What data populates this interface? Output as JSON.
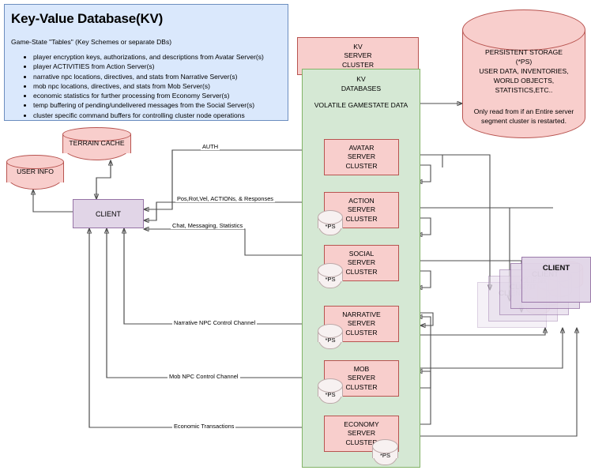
{
  "kv_panel": {
    "title": "Key-Value Database(KV)",
    "subtitle": "Game-State \"Tables\" (Key Schemes or separate DBs)",
    "bullets": [
      "player encryption keys, authorizations, and descriptions from Avatar Server(s)",
      "player ACTIVITIES from Action Server(s)",
      "narrative npc locations, directives, and stats from Narrative Server(s)",
      "mob npc locations, directives, and stats from Mob Server(s)",
      "economic statistics for further processing from Economy Server(s)",
      "temp buffering of pending/undelivered messages from the Social Server(s)",
      "cluster specific command buffers for controlling cluster node operations"
    ]
  },
  "kv_server_cluster": {
    "label": "KV\nSERVER\nCLUSTER",
    "line1": "KV",
    "line2": "SERVER",
    "line3": "CLUSTER"
  },
  "kv_databases": {
    "line1": "KV",
    "line2": "DATABASES",
    "line3": "VOLATILE GAMESTATE DATA"
  },
  "persistent_storage": {
    "title": "PERSISTENT STORAGE\n(*PS)\nUSER DATA, INVENTORIES,\nWORLD OBJECTS,\nSTATISTICS,ETC..",
    "note": "Only read from if an Entire server segment cluster is restarted."
  },
  "left_stores": [
    {
      "name": "user-info",
      "label": "USER INFO"
    },
    {
      "name": "terrain-cache",
      "label": "TERRAIN CACHE"
    }
  ],
  "client": {
    "label": "CLIENT"
  },
  "server_clusters": [
    {
      "id": "avatar",
      "name": "AVATAR",
      "line2": "SERVER",
      "line3": "CLUSTER",
      "ps": false,
      "ps_label": ""
    },
    {
      "id": "action",
      "name": "ACTION",
      "line2": "SERVER",
      "line3": "CLUSTER",
      "ps": true,
      "ps_label": "*PS"
    },
    {
      "id": "social",
      "name": "SOCIAL",
      "line2": "SERVER",
      "line3": "CLUSTER",
      "ps": true,
      "ps_label": "*PS"
    },
    {
      "id": "narrative",
      "name": "NARRATIVE",
      "line2": "SERVER",
      "line3": "CLUSTER",
      "ps": true,
      "ps_label": "*PS"
    },
    {
      "id": "mob",
      "name": "MOB",
      "line2": "SERVER",
      "line3": "CLUSTER",
      "ps": true,
      "ps_label": "*PS"
    },
    {
      "id": "economy",
      "name": "ECONOMY",
      "line2": "SERVER",
      "line3": "CLUSTER",
      "ps": true,
      "ps_label": "*PS"
    }
  ],
  "channels": [
    {
      "id": "auth",
      "label": "AUTH"
    },
    {
      "id": "posrotvel",
      "label": "Pos,Rot,Vel, ACTIONs, & Responses"
    },
    {
      "id": "chat",
      "label": "Chat, Messaging, Statistics"
    },
    {
      "id": "narrative",
      "label": "Narrative NPC Control Channel"
    },
    {
      "id": "mob",
      "label": "Mob NPC Control Channel"
    },
    {
      "id": "economic",
      "label": "Economic Transactions"
    }
  ],
  "client_stack": {
    "labels": [
      "CLIENT",
      "CLIENT",
      "CLIENT",
      "CLIENT",
      "CLIENT"
    ]
  },
  "colors": {
    "pink_fill": "#f8cecc",
    "pink_border": "#b85450",
    "green_fill": "#d5e8d4",
    "green_border": "#82b366",
    "blue_fill": "#dae8fc",
    "blue_border": "#6c8ebf",
    "purple_fill": "#e1d5e7",
    "purple_border": "#9673a6",
    "wire": "#4d4d4d"
  }
}
